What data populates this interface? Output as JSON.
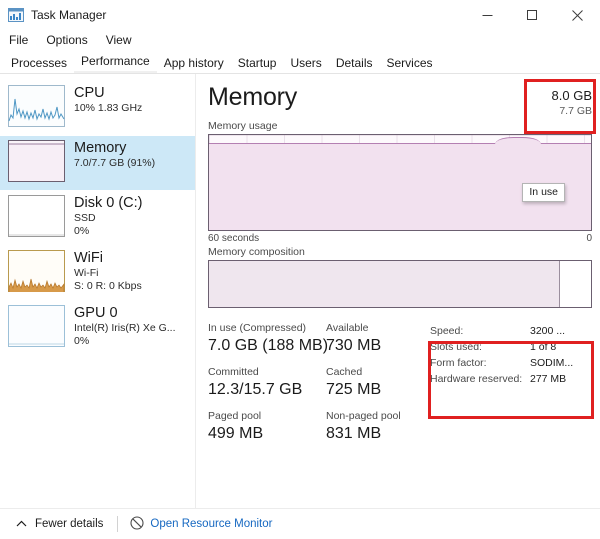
{
  "window": {
    "title": "Task Manager",
    "icon": "task-manager-icon",
    "controls": {
      "minimize": "minimize-icon",
      "maximize": "maximize-icon",
      "close": "close-icon"
    }
  },
  "menubar": {
    "items": [
      {
        "label": "File"
      },
      {
        "label": "Options"
      },
      {
        "label": "View"
      }
    ]
  },
  "tabs": {
    "active": "Performance",
    "items": [
      {
        "label": "Processes"
      },
      {
        "label": "Performance"
      },
      {
        "label": "App history"
      },
      {
        "label": "Startup"
      },
      {
        "label": "Users"
      },
      {
        "label": "Details"
      },
      {
        "label": "Services"
      }
    ]
  },
  "sidebar": {
    "items": [
      {
        "title": "CPU",
        "sub1": "10%  1.83 GHz",
        "sub2": "",
        "selected": false,
        "graph": "cpu-sparkline"
      },
      {
        "title": "Memory",
        "sub1": "7.0/7.7 GB (91%)",
        "sub2": "",
        "selected": true,
        "graph": "memory-fill"
      },
      {
        "title": "Disk 0 (C:)",
        "sub1": "SSD",
        "sub2": "0%",
        "selected": false,
        "graph": "disk-sparkline"
      },
      {
        "title": "WiFi",
        "sub1": "Wi-Fi",
        "sub2": "S: 0 R: 0 Kbps",
        "selected": false,
        "graph": "wifi-sparkline"
      },
      {
        "title": "GPU 0",
        "sub1": "Intel(R) Iris(R) Xe G...",
        "sub2": "0%",
        "selected": false,
        "graph": "gpu-sparkline"
      }
    ]
  },
  "main": {
    "title": "Memory",
    "total": "8.0 GB",
    "available_total": "7.7 GB",
    "usage_label": "Memory usage",
    "composition_label": "Memory composition",
    "tooltip": "In use",
    "axis_left": "60 seconds",
    "axis_right": "0",
    "stats": [
      [
        {
          "label": "In use (Compressed)",
          "value": "7.0 GB (188 MB)"
        },
        {
          "label": "Available",
          "value": "730 MB"
        }
      ],
      [
        {
          "label": "Committed",
          "value": "12.3/15.7 GB"
        },
        {
          "label": "Cached",
          "value": "725 MB"
        }
      ],
      [
        {
          "label": "Paged pool",
          "value": "499 MB"
        },
        {
          "label": "Non-paged pool",
          "value": "831 MB"
        }
      ]
    ],
    "specs": [
      {
        "key": "Speed:",
        "value": "3200 ..."
      },
      {
        "key": "Slots used:",
        "value": "1 of 8"
      },
      {
        "key": "Form factor:",
        "value": "SODIM..."
      },
      {
        "key": "Hardware reserved:",
        "value": "277 MB"
      }
    ]
  },
  "footer": {
    "fewer_details": "Fewer details",
    "resource_monitor": "Open Resource Monitor"
  },
  "chart_data": {
    "type": "area",
    "title": "Memory usage",
    "xlabel": "",
    "ylabel": "",
    "x_axis_left_label": "60 seconds",
    "x_axis_right_label": "0",
    "ylim": [
      0,
      8.0
    ],
    "y_unit": "GB",
    "grid": true,
    "legend": "none",
    "annotations": [
      "In use"
    ],
    "series": [
      {
        "name": "In use",
        "fill_color": "#f2e1ef",
        "line_color": "#b47fb2",
        "values": [
          7.0,
          7.0,
          7.0,
          7.0,
          7.0,
          7.0,
          7.0,
          7.0,
          7.0,
          7.0,
          7.0,
          7.0,
          7.0,
          7.0,
          7.0,
          7.0,
          7.0,
          7.0,
          7.0,
          7.0,
          7.0,
          7.0,
          7.0,
          7.0,
          7.0,
          7.0,
          7.0,
          7.0,
          7.0,
          7.0,
          7.0,
          7.0,
          7.0,
          7.0,
          7.0,
          7.0,
          7.0,
          7.0,
          7.0,
          7.0,
          7.0,
          7.0,
          7.0,
          7.0,
          7.0,
          7.1,
          7.2,
          7.2,
          7.1,
          7.0,
          7.0,
          7.0,
          7.0,
          7.0,
          7.0,
          7.0,
          7.0,
          7.0,
          7.0,
          7.0
        ]
      }
    ],
    "composition": {
      "type": "bar",
      "title": "Memory composition",
      "segments": [
        {
          "name": "In use",
          "fraction": 0.915,
          "color": "#efe6ee"
        },
        {
          "name": "Available",
          "fraction": 0.085,
          "color": "#ffffff"
        }
      ]
    }
  },
  "colors": {
    "selection": "#cde8f7",
    "accent_link": "#1668c1",
    "annotation_red": "#e02020",
    "memory_line": "#b47fb2",
    "memory_fill": "#f2e1ef"
  }
}
